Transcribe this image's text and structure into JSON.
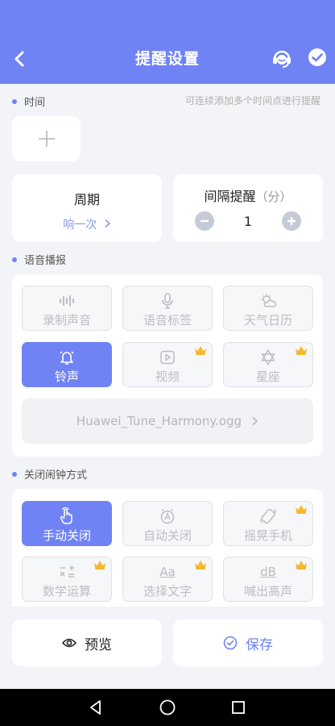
{
  "header": {
    "title": "提醒设置"
  },
  "time_section": {
    "label": "时间",
    "hint": "可连续添加多个时间点进行提醒"
  },
  "period": {
    "label": "周期",
    "value": "响一次"
  },
  "interval": {
    "label": "间隔提醒",
    "unit": "（分）",
    "value": "1"
  },
  "voice_section": {
    "label": "语音播报",
    "options": [
      {
        "label": "录制声音",
        "icon": "waveform-icon",
        "active": false,
        "premium": false
      },
      {
        "label": "语音标签",
        "icon": "microphone-icon",
        "active": false,
        "premium": false
      },
      {
        "label": "天气日历",
        "icon": "weather-icon",
        "active": false,
        "premium": false
      },
      {
        "label": "铃声",
        "icon": "bell-icon",
        "active": true,
        "premium": false
      },
      {
        "label": "视频",
        "icon": "video-icon",
        "active": false,
        "premium": true
      },
      {
        "label": "星座",
        "icon": "star-of-david-icon",
        "active": false,
        "premium": true
      }
    ],
    "file": "Huawei_Tune_Harmony.ogg"
  },
  "close_section": {
    "label": "关闭闹钟方式",
    "options": [
      {
        "label": "手动关闭",
        "icon": "tap-hand-icon",
        "active": true,
        "premium": false
      },
      {
        "label": "自动关闭",
        "icon": "auto-clock-icon",
        "active": false,
        "premium": false
      },
      {
        "label": "摇晃手机",
        "icon": "shake-phone-icon",
        "active": false,
        "premium": true
      },
      {
        "label": "数学运算",
        "icon": "math-ops-icon",
        "active": false,
        "premium": true
      },
      {
        "label": "选择文字",
        "icon_text": "Aa",
        "active": false,
        "premium": true
      },
      {
        "label": "喊出高声",
        "icon_text": "dB",
        "active": false,
        "premium": true
      }
    ]
  },
  "actions": {
    "preview": "预览",
    "save": "保存"
  },
  "colors": {
    "accent": "#6f83f4",
    "crown": "#f5b82e",
    "background": "#f3f4f8"
  }
}
